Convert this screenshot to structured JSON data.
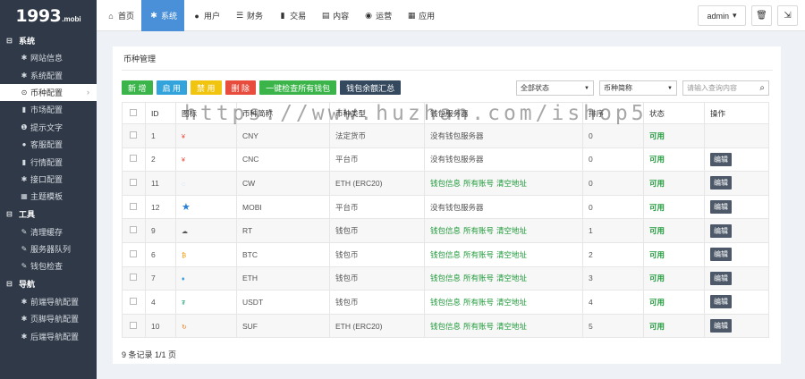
{
  "logo": {
    "big": "1993",
    "small": ".mobi"
  },
  "nav": [
    {
      "label": "首页",
      "icon": "home-icon",
      "glyph": "⌂"
    },
    {
      "label": "系统",
      "icon": "gear-icon",
      "glyph": "✱"
    },
    {
      "label": "用户",
      "icon": "user-icon",
      "glyph": "●"
    },
    {
      "label": "财务",
      "icon": "list-icon",
      "glyph": "☰"
    },
    {
      "label": "交易",
      "icon": "chart-icon",
      "glyph": "▮"
    },
    {
      "label": "内容",
      "icon": "doc-icon",
      "glyph": "▤"
    },
    {
      "label": "运营",
      "icon": "globe-icon",
      "glyph": "◉"
    },
    {
      "label": "应用",
      "icon": "grid-icon",
      "glyph": "▦"
    }
  ],
  "topright": {
    "admin_label": "admin",
    "caret": "▾",
    "trash_glyph": "🗑",
    "logout_glyph": "⇲"
  },
  "sidebar": {
    "groups": [
      {
        "label": "系统",
        "glyph": "⊟",
        "items": [
          {
            "label": "网站信息",
            "glyph": "✱"
          },
          {
            "label": "系统配置",
            "glyph": "✱"
          },
          {
            "label": "币种配置",
            "glyph": "⊙"
          },
          {
            "label": "市场配置",
            "glyph": "▮"
          },
          {
            "label": "提示文字",
            "glyph": "❶"
          },
          {
            "label": "客服配置",
            "glyph": "●"
          },
          {
            "label": "行情配置",
            "glyph": "▮"
          },
          {
            "label": "接口配置",
            "glyph": "✱"
          },
          {
            "label": "主题模板",
            "glyph": "▦"
          }
        ]
      },
      {
        "label": "工具",
        "glyph": "⊟",
        "items": [
          {
            "label": "清理缓存",
            "glyph": "✎"
          },
          {
            "label": "服务器队列",
            "glyph": "✎"
          },
          {
            "label": "钱包检查",
            "glyph": "✎"
          }
        ]
      },
      {
        "label": "导航",
        "glyph": "⊟",
        "items": [
          {
            "label": "前端导航配置",
            "glyph": "✱"
          },
          {
            "label": "页脚导航配置",
            "glyph": "✱"
          },
          {
            "label": "后端导航配置",
            "glyph": "✱"
          }
        ]
      }
    ],
    "chevron": "›"
  },
  "panel": {
    "title": "币种管理",
    "buttons": [
      {
        "label": "新 增",
        "color": "#3bb54a"
      },
      {
        "label": "启 用",
        "color": "#33a3dc"
      },
      {
        "label": "禁 用",
        "color": "#f1c40f"
      },
      {
        "label": "删 除",
        "color": "#e74c3c"
      },
      {
        "label": "一键检查所有钱包",
        "color": "#3bb54a"
      },
      {
        "label": "钱包余额汇总",
        "color": "#34495e"
      }
    ],
    "filters": {
      "status": "全部状态",
      "coin_name": "币种简称",
      "search_placeholder": "请输入查询内容",
      "caret": "▼",
      "search_glyph": "⌕"
    },
    "watermark": "https://www.huzhan.com/ishop5"
  },
  "table": {
    "headers": [
      "ID",
      "图标",
      "币种简称",
      "币种类型",
      "钱包服务器",
      "排序",
      "状态",
      "操作"
    ],
    "rows": [
      {
        "id": "1",
        "icon": "¥",
        "icon_color": "#e74c3c",
        "name": "CNY",
        "type": "法定货币",
        "server": "没有钱包服务器",
        "links": [],
        "sort": "0",
        "status": "可用",
        "action": ""
      },
      {
        "id": "2",
        "icon": "¥",
        "icon_color": "#e74c3c",
        "name": "CNC",
        "type": "平台币",
        "server": "没有钱包服务器",
        "links": [],
        "sort": "0",
        "status": "可用",
        "action": "编辑"
      },
      {
        "id": "11",
        "icon": "◌",
        "icon_color": "#9ad0ec",
        "name": "CW",
        "type": "ETH (ERC20)",
        "server": "",
        "links": [
          "钱包信息",
          "所有账号",
          "清空地址"
        ],
        "sort": "0",
        "status": "可用",
        "action": "编辑"
      },
      {
        "id": "12",
        "icon": "★",
        "icon_color": "#2a7fd4",
        "name": "MOBI",
        "type": "平台币",
        "server": "没有钱包服务器",
        "links": [],
        "sort": "0",
        "status": "可用",
        "action": "编辑"
      },
      {
        "id": "9",
        "icon": "☁",
        "icon_color": "#555555",
        "name": "RT",
        "type": "钱包币",
        "server": "",
        "links": [
          "钱包信息",
          "所有账号",
          "清空地址"
        ],
        "sort": "1",
        "status": "可用",
        "action": "编辑"
      },
      {
        "id": "6",
        "icon": "₿",
        "icon_color": "#f39c12",
        "name": "BTC",
        "type": "钱包币",
        "server": "",
        "links": [
          "钱包信息",
          "所有账号",
          "清空地址"
        ],
        "sort": "2",
        "status": "可用",
        "action": "编辑"
      },
      {
        "id": "7",
        "icon": "♦",
        "icon_color": "#3498db",
        "name": "ETH",
        "type": "钱包币",
        "server": "",
        "links": [
          "钱包信息",
          "所有账号",
          "清空地址"
        ],
        "sort": "3",
        "status": "可用",
        "action": "编辑"
      },
      {
        "id": "4",
        "icon": "₮",
        "icon_color": "#26a17b",
        "name": "USDT",
        "type": "钱包币",
        "server": "",
        "links": [
          "钱包信息",
          "所有账号",
          "清空地址"
        ],
        "sort": "4",
        "status": "可用",
        "action": "编辑"
      },
      {
        "id": "10",
        "icon": "↻",
        "icon_color": "#e67e22",
        "name": "SUF",
        "type": "ETH (ERC20)",
        "server": "",
        "links": [
          "钱包信息",
          "所有账号",
          "清空地址"
        ],
        "sort": "5",
        "status": "可用",
        "action": "编辑"
      }
    ]
  },
  "footer": "9 条记录 1/1 页",
  "colors": {
    "sidebar_bg": "#2f3947",
    "active_nav": "#4a90d9",
    "status_green": "#1f9a3a",
    "edit_btn": "#4d5868"
  }
}
